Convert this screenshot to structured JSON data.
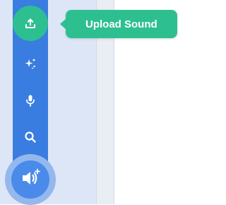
{
  "sound_menu": {
    "tooltip_label": "Upload Sound",
    "items": [
      {
        "icon": "upload-icon",
        "state": "hovered"
      },
      {
        "icon": "sparkle-icon"
      },
      {
        "icon": "microphone-icon"
      },
      {
        "icon": "search-icon"
      }
    ],
    "main_button_icon": "speaker-plus-icon"
  },
  "colors": {
    "menu_blue": "#3a7de0",
    "hover_green": "#2ebf91",
    "main_button_blue": "#4a8bea",
    "main_button_halo": "#94b8ee",
    "pane_background": "#dde6f6",
    "icon_white": "#ffffff"
  }
}
